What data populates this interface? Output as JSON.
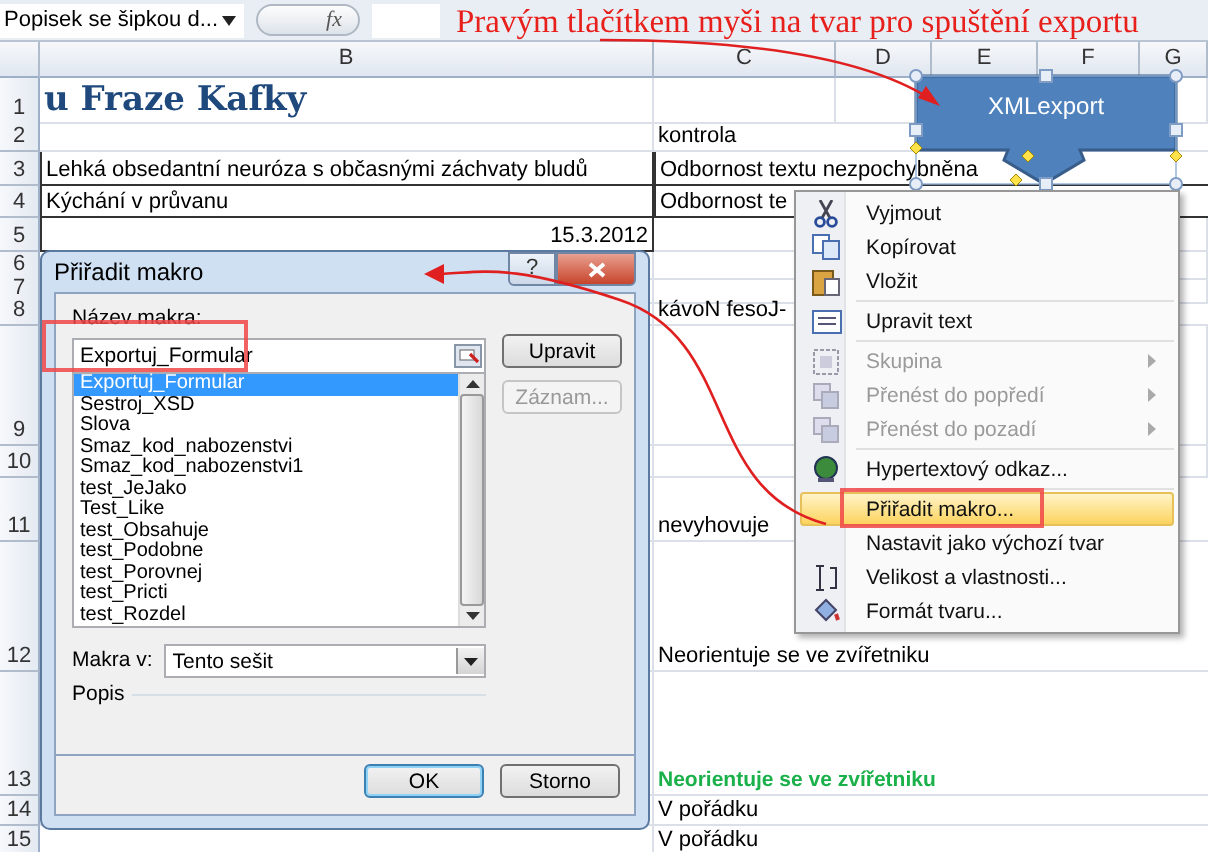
{
  "formula_bar": {
    "name_box": "Popisek se šipkou d...",
    "function_label": "fx"
  },
  "annotation": {
    "text": "Pravým tlačítkem myši na tvar pro spuštění exportu"
  },
  "columns": [
    "B",
    "C",
    "D",
    "E",
    "F",
    "G"
  ],
  "rows": [
    {
      "number": "1",
      "b": {
        "text": "u Fraze Kafky",
        "kind": "title"
      }
    },
    {
      "number": "2",
      "c": {
        "text": "kontrola",
        "kind": "text"
      }
    },
    {
      "number": "3",
      "b": {
        "text": "Lehká obsedantní neuróza s občasnými záchvaty bludů",
        "kind": "boxed"
      },
      "c": {
        "text": "Odbornost textu nezpochybněna",
        "kind": "boxed"
      }
    },
    {
      "number": "4",
      "b": {
        "text": "Kýchání v průvanu",
        "kind": "boxed"
      },
      "c": {
        "text": "Odbornost te",
        "kind": "boxed"
      }
    },
    {
      "number": "5",
      "b": {
        "text": "15.3.2012",
        "kind": "date"
      }
    },
    {
      "number": "6"
    },
    {
      "number": "7"
    },
    {
      "number": "8",
      "c": {
        "text": "kávoN fesoJ-",
        "kind": "text"
      }
    },
    {
      "number": "9"
    },
    {
      "number": "10"
    },
    {
      "number": "11",
      "c": {
        "text": "nevyhovuje",
        "kind": "text"
      }
    },
    {
      "number": "12",
      "c": {
        "text": "Neorientuje se ve zvířetniku",
        "kind": "text"
      }
    },
    {
      "number": "13",
      "c": {
        "text": "Neorientuje se ve zvířetniku",
        "kind": "green"
      }
    },
    {
      "number": "14",
      "c": {
        "text": "V pořádku",
        "kind": "text"
      }
    },
    {
      "number": "15",
      "c": {
        "text": "V pořádku",
        "kind": "text"
      }
    }
  ],
  "shape": {
    "label": "XMLexport",
    "selected": true
  },
  "context_menu": [
    {
      "label": "Vyjmout",
      "disabled": false,
      "submenu": false,
      "selected": false,
      "separator_before": false
    },
    {
      "label": "Kopírovat",
      "disabled": false,
      "submenu": false,
      "selected": false,
      "separator_before": false
    },
    {
      "label": "Vložit",
      "disabled": false,
      "submenu": false,
      "selected": false,
      "separator_before": false
    },
    {
      "label": "Upravit text",
      "disabled": false,
      "submenu": false,
      "selected": false,
      "separator_before": true
    },
    {
      "label": "Skupina",
      "disabled": true,
      "submenu": true,
      "selected": false,
      "separator_before": true
    },
    {
      "label": "Přenést do popředí",
      "disabled": true,
      "submenu": true,
      "selected": false,
      "separator_before": false
    },
    {
      "label": "Přenést do pozadí",
      "disabled": true,
      "submenu": true,
      "selected": false,
      "separator_before": false
    },
    {
      "label": "Hypertextový odkaz...",
      "disabled": false,
      "submenu": false,
      "selected": false,
      "separator_before": true
    },
    {
      "label": "Přiřadit makro...",
      "disabled": false,
      "submenu": false,
      "selected": true,
      "separator_before": true
    },
    {
      "label": "Nastavit jako výchozí tvar",
      "disabled": false,
      "submenu": false,
      "selected": false,
      "separator_before": false
    },
    {
      "label": "Velikost a vlastnosti...",
      "disabled": false,
      "submenu": false,
      "selected": false,
      "separator_before": false
    },
    {
      "label": "Formát tvaru...",
      "disabled": false,
      "submenu": false,
      "selected": false,
      "separator_before": false
    }
  ],
  "dialog": {
    "title": "Přiřadit makro",
    "help": "?",
    "name_label": "Název makra:",
    "name_value": "Exportuj_Formular",
    "side_buttons": [
      {
        "label": "Upravit",
        "disabled": false
      },
      {
        "label": "Záznam...",
        "disabled": true
      }
    ],
    "macros": [
      {
        "label": "Exportuj_Formular",
        "selected": true
      },
      {
        "label": "Sestroj_XSD",
        "selected": false
      },
      {
        "label": "Slova",
        "selected": false
      },
      {
        "label": "Smaz_kod_nabozenstvi",
        "selected": false
      },
      {
        "label": "Smaz_kod_nabozenstvi1",
        "selected": false
      },
      {
        "label": "test_JeJako",
        "selected": false
      },
      {
        "label": "Test_Like",
        "selected": false
      },
      {
        "label": "test_Obsahuje",
        "selected": false
      },
      {
        "label": "test_Podobne",
        "selected": false
      },
      {
        "label": "test_Porovnej",
        "selected": false
      },
      {
        "label": "test_Pricti",
        "selected": false
      },
      {
        "label": "test_Rozdel",
        "selected": false
      }
    ],
    "location_label": "Makra v:",
    "location_value": "Tento sešit",
    "description_label": "Popis",
    "footer_buttons": [
      {
        "label": "OK",
        "default": true
      },
      {
        "label": "Storno",
        "default": false
      }
    ]
  }
}
